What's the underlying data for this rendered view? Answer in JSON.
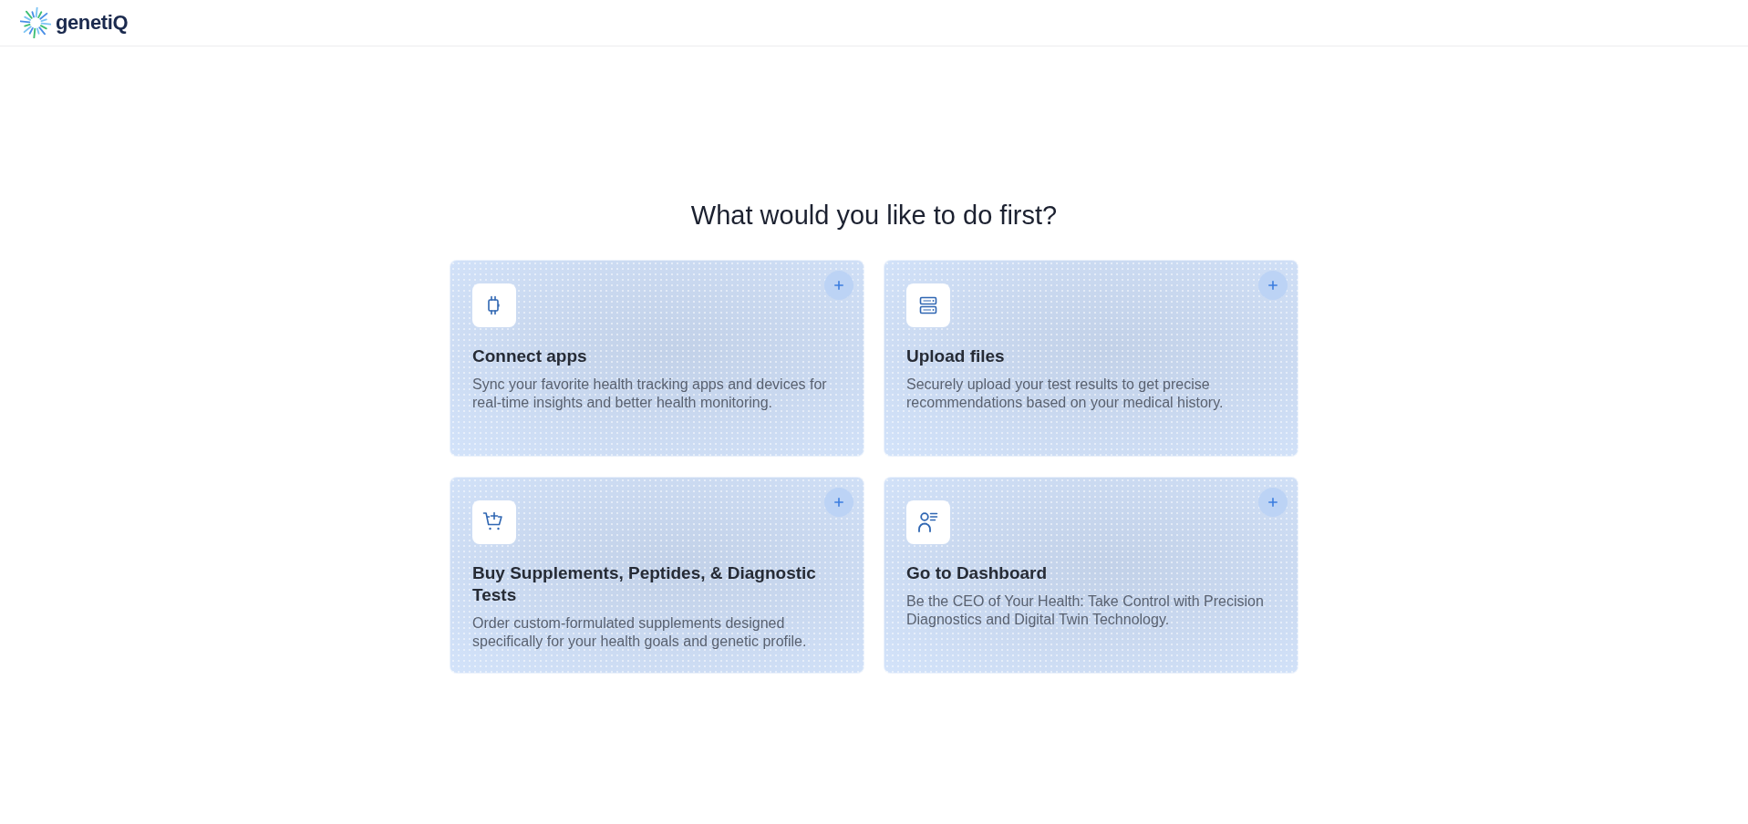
{
  "header": {
    "logo_text": "genetiQ"
  },
  "heading": "What would you like to do first?",
  "options": [
    {
      "title": "Connect apps",
      "description": "Sync your favorite health tracking apps and devices for real-time insights and better health monitoring."
    },
    {
      "title": "Upload files",
      "description": "Securely upload your test results to get precise recommendations based on your medical history."
    },
    {
      "title": "Buy Supplements, Peptides, & Diagnostic Tests",
      "description": "Order custom-formulated supplements designed specifically for your health goals and genetic profile."
    },
    {
      "title": "Go to Dashboard",
      "description": "Be the CEO of Your Health: Take Control with Precision Diagnostics and Digital Twin Technology."
    }
  ]
}
